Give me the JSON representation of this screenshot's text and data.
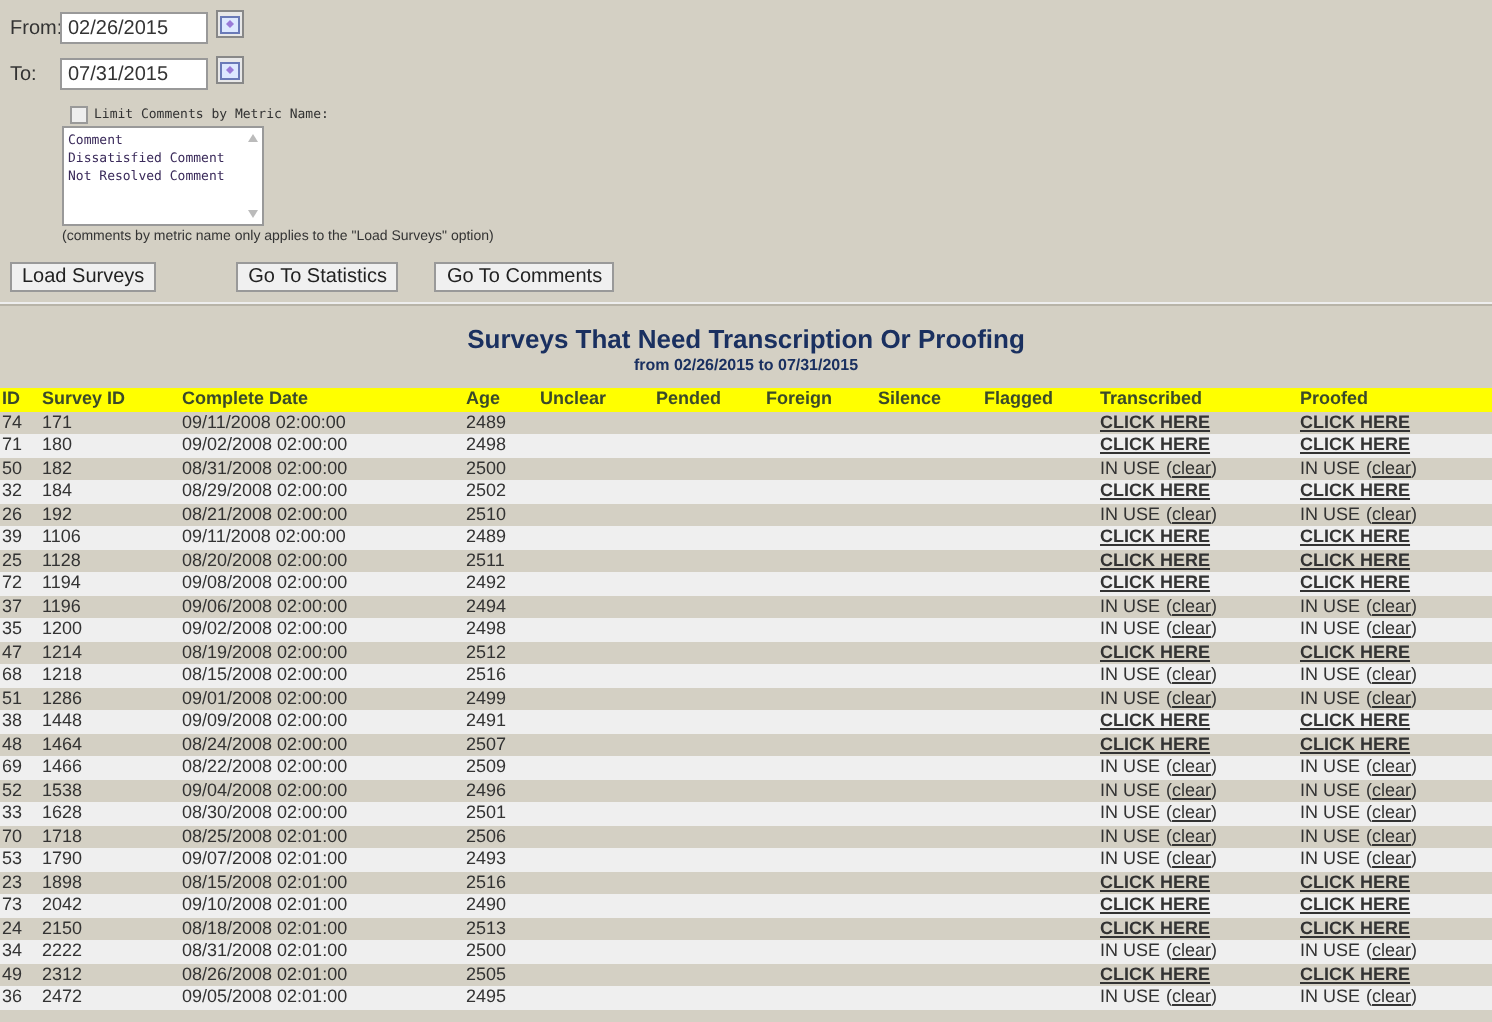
{
  "filters": {
    "from_label": "From:",
    "from_value": "02/26/2015",
    "to_label": "To:",
    "to_value": "07/31/2015",
    "limit": {
      "label": "Limit Comments by Metric Name:",
      "checked": false
    },
    "metrics": [
      "Comment",
      "Dissatisfied Comment",
      "Not Resolved Comment"
    ],
    "note": "(comments by metric name only applies to the \"Load Surveys\" option)"
  },
  "buttons": [
    "Load Surveys",
    "Go To Statistics",
    "Go To Comments"
  ],
  "report": {
    "title": "Surveys That Need Transcription Or Proofing",
    "subtitle": "from 02/26/2015 to 07/31/2015"
  },
  "table": {
    "columns": [
      "ID",
      "Survey ID",
      "Complete Date",
      "Age",
      "Unclear",
      "Pended",
      "Foreign",
      "Silence",
      "Flagged",
      "Transcribed",
      "Proofed"
    ],
    "rows": [
      {
        "id": "74",
        "survey_id": "171",
        "date": "09/11/2008 02:00:00",
        "age": "2489",
        "transcribed": {
          "kind": "link",
          "label": "CLICK HERE"
        },
        "proofed": {
          "kind": "link",
          "label": "CLICK HERE"
        }
      },
      {
        "id": "71",
        "survey_id": "180",
        "date": "09/02/2008 02:00:00",
        "age": "2498",
        "transcribed": {
          "kind": "link",
          "label": "CLICK HERE"
        },
        "proofed": {
          "kind": "link",
          "label": "CLICK HERE"
        }
      },
      {
        "id": "50",
        "survey_id": "182",
        "date": "08/31/2008 02:00:00",
        "age": "2500",
        "transcribed": {
          "kind": "in_use",
          "label": "IN USE",
          "open": "(",
          "link": "clear",
          "close": ")"
        },
        "proofed": {
          "kind": "in_use",
          "label": "IN USE",
          "open": "(",
          "link": "clear",
          "close": ")"
        }
      },
      {
        "id": "32",
        "survey_id": "184",
        "date": "08/29/2008 02:00:00",
        "age": "2502",
        "transcribed": {
          "kind": "link",
          "label": "CLICK HERE"
        },
        "proofed": {
          "kind": "link",
          "label": "CLICK HERE"
        }
      },
      {
        "id": "26",
        "survey_id": "192",
        "date": "08/21/2008 02:00:00",
        "age": "2510",
        "transcribed": {
          "kind": "in_use",
          "label": "IN USE",
          "open": "(",
          "link": "clear",
          "close": ")"
        },
        "proofed": {
          "kind": "in_use",
          "label": "IN USE",
          "open": "(",
          "link": "clear",
          "close": ")"
        }
      },
      {
        "id": "39",
        "survey_id": "1106",
        "date": "09/11/2008 02:00:00",
        "age": "2489",
        "transcribed": {
          "kind": "link",
          "label": "CLICK HERE"
        },
        "proofed": {
          "kind": "link",
          "label": "CLICK HERE"
        }
      },
      {
        "id": "25",
        "survey_id": "1128",
        "date": "08/20/2008 02:00:00",
        "age": "2511",
        "transcribed": {
          "kind": "link",
          "label": "CLICK HERE"
        },
        "proofed": {
          "kind": "link",
          "label": "CLICK HERE"
        }
      },
      {
        "id": "72",
        "survey_id": "1194",
        "date": "09/08/2008 02:00:00",
        "age": "2492",
        "transcribed": {
          "kind": "link",
          "label": "CLICK HERE"
        },
        "proofed": {
          "kind": "link",
          "label": "CLICK HERE"
        }
      },
      {
        "id": "37",
        "survey_id": "1196",
        "date": "09/06/2008 02:00:00",
        "age": "2494",
        "transcribed": {
          "kind": "in_use",
          "label": "IN USE",
          "open": "(",
          "link": "clear",
          "close": ")"
        },
        "proofed": {
          "kind": "in_use",
          "label": "IN USE",
          "open": "(",
          "link": "clear",
          "close": ")"
        }
      },
      {
        "id": "35",
        "survey_id": "1200",
        "date": "09/02/2008 02:00:00",
        "age": "2498",
        "transcribed": {
          "kind": "in_use",
          "label": "IN USE",
          "open": "(",
          "link": "clear",
          "close": ")"
        },
        "proofed": {
          "kind": "in_use",
          "label": "IN USE",
          "open": "(",
          "link": "clear",
          "close": ")"
        }
      },
      {
        "id": "47",
        "survey_id": "1214",
        "date": "08/19/2008 02:00:00",
        "age": "2512",
        "transcribed": {
          "kind": "link",
          "label": "CLICK HERE"
        },
        "proofed": {
          "kind": "link",
          "label": "CLICK HERE"
        }
      },
      {
        "id": "68",
        "survey_id": "1218",
        "date": "08/15/2008 02:00:00",
        "age": "2516",
        "transcribed": {
          "kind": "in_use",
          "label": "IN USE",
          "open": "(",
          "link": "clear",
          "close": ")"
        },
        "proofed": {
          "kind": "in_use",
          "label": "IN USE",
          "open": "(",
          "link": "clear",
          "close": ")"
        }
      },
      {
        "id": "51",
        "survey_id": "1286",
        "date": "09/01/2008 02:00:00",
        "age": "2499",
        "transcribed": {
          "kind": "in_use",
          "label": "IN USE",
          "open": "(",
          "link": "clear",
          "close": ")"
        },
        "proofed": {
          "kind": "in_use",
          "label": "IN USE",
          "open": "(",
          "link": "clear",
          "close": ")"
        }
      },
      {
        "id": "38",
        "survey_id": "1448",
        "date": "09/09/2008 02:00:00",
        "age": "2491",
        "transcribed": {
          "kind": "link",
          "label": "CLICK HERE"
        },
        "proofed": {
          "kind": "link",
          "label": "CLICK HERE"
        }
      },
      {
        "id": "48",
        "survey_id": "1464",
        "date": "08/24/2008 02:00:00",
        "age": "2507",
        "transcribed": {
          "kind": "link",
          "label": "CLICK HERE"
        },
        "proofed": {
          "kind": "link",
          "label": "CLICK HERE"
        }
      },
      {
        "id": "69",
        "survey_id": "1466",
        "date": "08/22/2008 02:00:00",
        "age": "2509",
        "transcribed": {
          "kind": "in_use",
          "label": "IN USE",
          "open": "(",
          "link": "clear",
          "close": ")"
        },
        "proofed": {
          "kind": "in_use",
          "label": "IN USE",
          "open": "(",
          "link": "clear",
          "close": ")"
        }
      },
      {
        "id": "52",
        "survey_id": "1538",
        "date": "09/04/2008 02:00:00",
        "age": "2496",
        "transcribed": {
          "kind": "in_use",
          "label": "IN USE",
          "open": "(",
          "link": "clear",
          "close": ")"
        },
        "proofed": {
          "kind": "in_use",
          "label": "IN USE",
          "open": "(",
          "link": "clear",
          "close": ")"
        }
      },
      {
        "id": "33",
        "survey_id": "1628",
        "date": "08/30/2008 02:00:00",
        "age": "2501",
        "transcribed": {
          "kind": "in_use",
          "label": "IN USE",
          "open": "(",
          "link": "clear",
          "close": ")"
        },
        "proofed": {
          "kind": "in_use",
          "label": "IN USE",
          "open": "(",
          "link": "clear",
          "close": ")"
        }
      },
      {
        "id": "70",
        "survey_id": "1718",
        "date": "08/25/2008 02:01:00",
        "age": "2506",
        "transcribed": {
          "kind": "in_use",
          "label": "IN USE",
          "open": "(",
          "link": "clear",
          "close": ")"
        },
        "proofed": {
          "kind": "in_use",
          "label": "IN USE",
          "open": "(",
          "link": "clear",
          "close": ")"
        }
      },
      {
        "id": "53",
        "survey_id": "1790",
        "date": "09/07/2008 02:01:00",
        "age": "2493",
        "transcribed": {
          "kind": "in_use",
          "label": "IN USE",
          "open": "(",
          "link": "clear",
          "close": ")"
        },
        "proofed": {
          "kind": "in_use",
          "label": "IN USE",
          "open": "(",
          "link": "clear",
          "close": ")"
        }
      },
      {
        "id": "23",
        "survey_id": "1898",
        "date": "08/15/2008 02:01:00",
        "age": "2516",
        "transcribed": {
          "kind": "link",
          "label": "CLICK HERE"
        },
        "proofed": {
          "kind": "link",
          "label": "CLICK HERE"
        }
      },
      {
        "id": "73",
        "survey_id": "2042",
        "date": "09/10/2008 02:01:00",
        "age": "2490",
        "transcribed": {
          "kind": "link",
          "label": "CLICK HERE"
        },
        "proofed": {
          "kind": "link",
          "label": "CLICK HERE"
        }
      },
      {
        "id": "24",
        "survey_id": "2150",
        "date": "08/18/2008 02:01:00",
        "age": "2513",
        "transcribed": {
          "kind": "link",
          "label": "CLICK HERE"
        },
        "proofed": {
          "kind": "link",
          "label": "CLICK HERE"
        }
      },
      {
        "id": "34",
        "survey_id": "2222",
        "date": "08/31/2008 02:01:00",
        "age": "2500",
        "transcribed": {
          "kind": "in_use",
          "label": "IN USE",
          "open": "(",
          "link": "clear",
          "close": ")"
        },
        "proofed": {
          "kind": "in_use",
          "label": "IN USE",
          "open": "(",
          "link": "clear",
          "close": ")"
        }
      },
      {
        "id": "49",
        "survey_id": "2312",
        "date": "08/26/2008 02:01:00",
        "age": "2505",
        "transcribed": {
          "kind": "link",
          "label": "CLICK HERE"
        },
        "proofed": {
          "kind": "link",
          "label": "CLICK HERE"
        }
      },
      {
        "id": "36",
        "survey_id": "2472",
        "date": "09/05/2008 02:01:00",
        "age": "2495",
        "transcribed": {
          "kind": "in_use",
          "label": "IN USE",
          "open": "(",
          "link": "clear",
          "close": ")"
        },
        "proofed": {
          "kind": "in_use",
          "label": "IN USE",
          "open": "(",
          "link": "clear",
          "close": ")"
        }
      }
    ]
  }
}
